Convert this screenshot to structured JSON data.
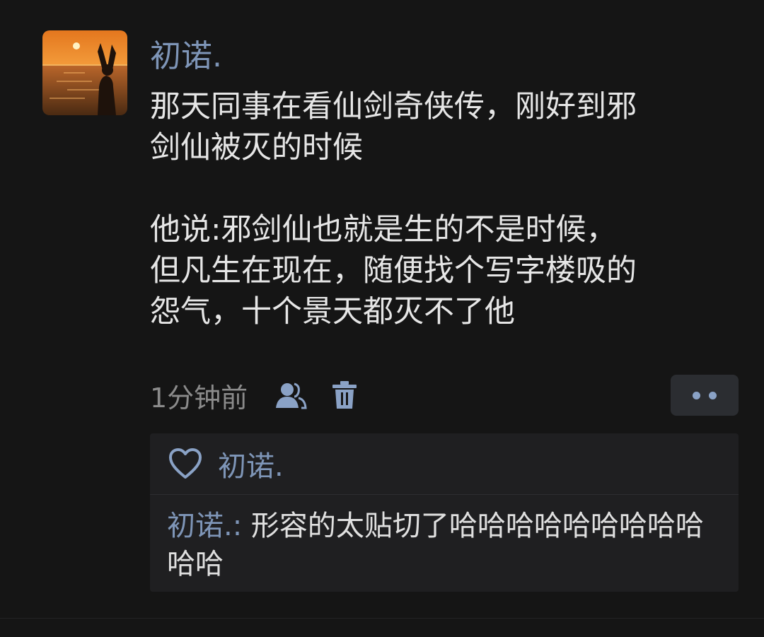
{
  "post": {
    "username": "初诺.",
    "lines_para1": [
      "那天同事在看仙剑奇侠传，刚好到邪",
      "剑仙被灭的时候"
    ],
    "lines_para2": [
      "他说:邪剑仙也就是生的不是时候，",
      "但凡生在现在，随便找个写字楼吸的",
      "怨气，十个景天都灭不了他"
    ],
    "time": "1分钟前",
    "privacy_icon": "people-icon",
    "delete_icon": "trash-icon",
    "more_icon": "two-dots-icon"
  },
  "likes": {
    "icon": "heart-outline-icon",
    "names": "初诺."
  },
  "comments": [
    {
      "author": "初诺.",
      "separator": ": ",
      "text": "形容的太贴切了哈哈哈哈哈哈哈哈哈哈哈"
    }
  ],
  "colors": {
    "background": "#151515",
    "name_link": "#7e95b7",
    "text": "#e6e6e6",
    "muted": "#8b8b8b",
    "panel": "#1f1f21"
  }
}
